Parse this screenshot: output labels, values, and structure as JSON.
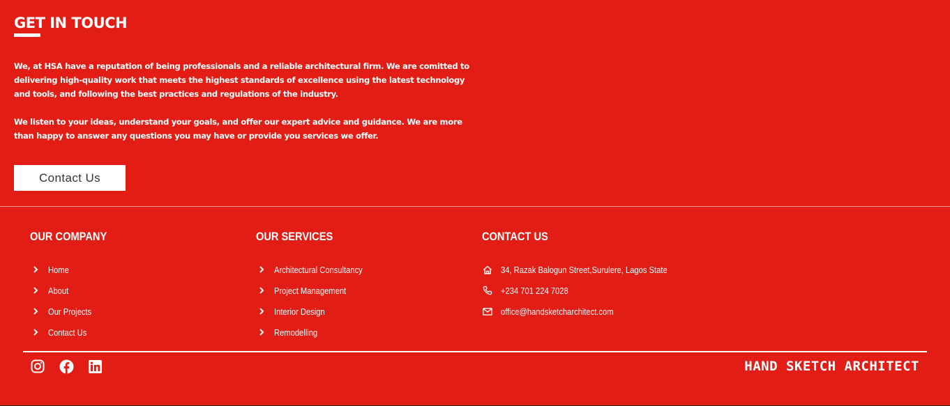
{
  "get_in_touch": {
    "title": "GET IN TOUCH",
    "paragraph_1": "We, at HSA have a reputation of being professionals and a reliable architectural firm. We are comitted to delivering high-quality work that meets the highest standards of excellence using the latest technology and tools, and following the best practices and regulations of the industry.",
    "paragraph_2": "We listen to your ideas, understand your goals, and offer our expert advice and guidance. We are more than happy to answer any questions you may have or provide you services we offer.",
    "button_label": "Contact Us"
  },
  "company": {
    "title": "OUR COMPANY",
    "items": [
      {
        "label": "Home"
      },
      {
        "label": "About"
      },
      {
        "label": "Our Projects"
      },
      {
        "label": "Contact Us"
      }
    ]
  },
  "services": {
    "title": "OUR SERVICES",
    "items": [
      {
        "label": "Architectural Consultancy"
      },
      {
        "label": "Project Management"
      },
      {
        "label": "Interior Design"
      },
      {
        "label": "Remodelling"
      }
    ]
  },
  "contact": {
    "title": "CONTACT US",
    "address": "34, Razak Balogun Street,Surulere, Lagos State",
    "phone": "+234 701 224 7028",
    "email": "office@handsketcharchitect.com"
  },
  "social": {
    "icons": [
      "instagram-icon",
      "facebook-icon",
      "linkedin-icon"
    ]
  },
  "brand": {
    "name": "HAND SKETCH ARCHITECT"
  },
  "colors": {
    "background": "#e11d15",
    "text": "#ffffff",
    "button_bg": "#ffffff",
    "button_text": "#333333"
  }
}
